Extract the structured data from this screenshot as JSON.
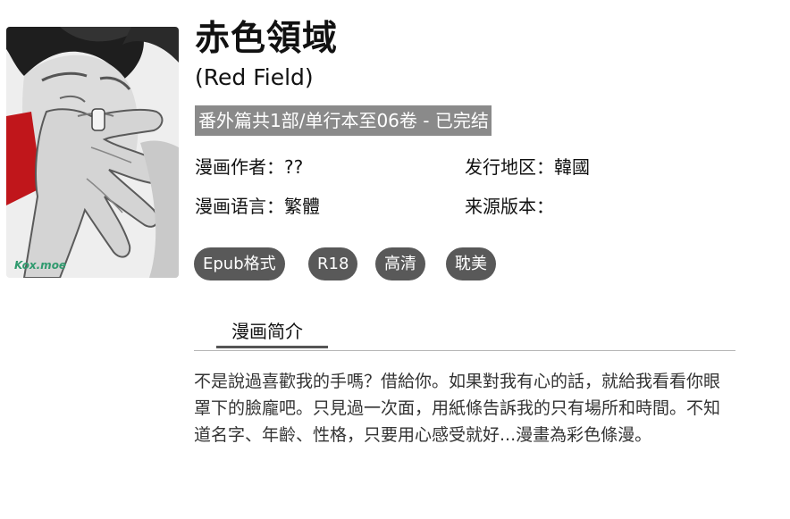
{
  "cover": {
    "watermark": "Kox.moe"
  },
  "book": {
    "title": "赤色領域",
    "subtitle": "(Red Field)",
    "status": "番外篇共1部/单行本至06卷 - 已完结"
  },
  "meta": {
    "author_label": "漫画作者：",
    "author_value": "??",
    "region_label": "发行地区：",
    "region_value": "韓國",
    "language_label": "漫画语言：",
    "language_value": "繁體",
    "source_label": "来源版本：",
    "source_value": ""
  },
  "tags": [
    "Epub格式",
    "R18",
    "高清",
    "耽美"
  ],
  "tabs": {
    "intro_label": "漫画简介"
  },
  "description": "不是說過喜歡我的手嗎？借給你。如果對我有心的話，就給我看看你眼罩下的臉龐吧。只見過一次面，用紙條告訴我的只有場所和時間。不知道名字、年齡、性格，只要用心感受就好...漫畫為彩色條漫。",
  "colors": {
    "status_bg": "#8a8a8a",
    "tag_bg": "#595959",
    "watermark": "#2f9a6e",
    "cover_red": "#c0161b"
  }
}
